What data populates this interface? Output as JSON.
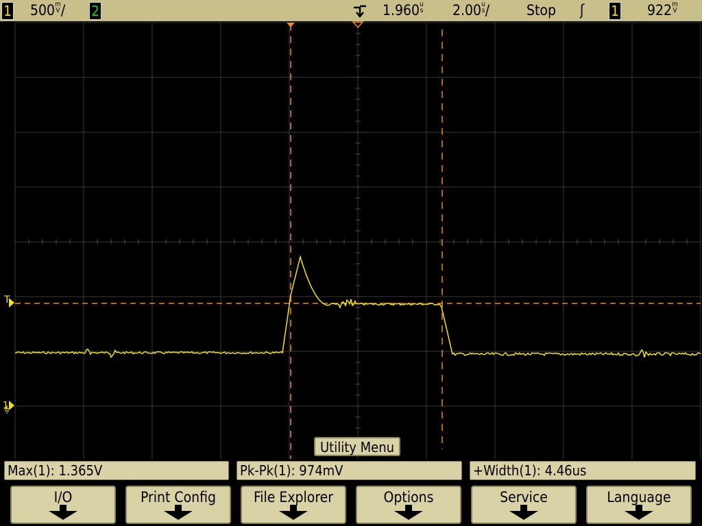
{
  "top_bar": {
    "ch1_number": "1",
    "ch1_scale": "500",
    "ch1_unit_top": "m",
    "ch1_unit_bottom": "V",
    "ch1_slash": "/",
    "ch2_number": "2",
    "time_delay": "1.960",
    "time_delay_unit_top": "u",
    "time_delay_unit_bottom": "s",
    "time_scale": "2.00",
    "time_scale_unit_top": "u",
    "time_scale_unit_bottom": "s",
    "time_scale_slash": "/",
    "run_state": "Stop",
    "trigger_slope_symbol": "ʃ",
    "trigger_channel": "1",
    "trigger_level": "922",
    "trigger_level_unit_top": "m",
    "trigger_level_unit_bottom": "V"
  },
  "screen": {
    "trigger_marker": "T",
    "ground_marker": "1",
    "utility_menu_label": "Utility Menu"
  },
  "measurements": [
    {
      "label": "Max(1): 1.365V"
    },
    {
      "label": "Pk-Pk(1): 974mV"
    },
    {
      "label": "+Width(1): 4.46us"
    }
  ],
  "softkeys": [
    {
      "label": "I/O"
    },
    {
      "label": "Print Config"
    },
    {
      "label": "File Explorer"
    },
    {
      "label": "Options"
    },
    {
      "label": "Service"
    },
    {
      "label": "Language"
    }
  ],
  "colors": {
    "channel1": "#f2e11c",
    "channel2": "#2ec82e",
    "cursor": "#e88a2a",
    "status_bar": "#c8bf8a",
    "softkey": "#d9d2a6"
  }
}
